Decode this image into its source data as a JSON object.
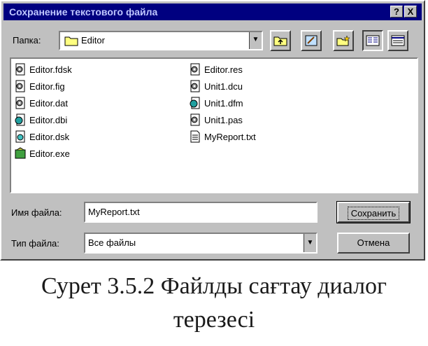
{
  "window": {
    "title": "Сохранение текстового файла",
    "help_button": "?",
    "close_button": "X"
  },
  "toolbar": {
    "folder_label": "Папка:",
    "folder_value": "Editor"
  },
  "files": [
    {
      "name": "Editor.fdsk",
      "icon": "gear-file-icon"
    },
    {
      "name": "Editor.fig",
      "icon": "gear-file-icon"
    },
    {
      "name": "Editor.dat",
      "icon": "gear-file-icon"
    },
    {
      "name": "Editor.dbi",
      "icon": "globe-file-icon"
    },
    {
      "name": "Editor.dsk",
      "icon": "disk-file-icon"
    },
    {
      "name": "Editor.exe",
      "icon": "exe-file-icon"
    },
    {
      "name": "Editor.res",
      "icon": "gear-file-icon"
    },
    {
      "name": "Unit1.dcu",
      "icon": "gear-file-icon"
    },
    {
      "name": "Unit1.dfm",
      "icon": "globe-file-icon"
    },
    {
      "name": "Unit1.pas",
      "icon": "gear-file-icon"
    },
    {
      "name": "MyReport.txt",
      "icon": "text-file-icon"
    }
  ],
  "form": {
    "filename_label": "Имя файла:",
    "filename_value": "MyReport.txt",
    "filetype_label": "Тип файла:",
    "filetype_value": "Все файлы",
    "save_button": "Сохранить",
    "cancel_button": "Отмена"
  },
  "caption": {
    "line1": "Сурет 3.5.2 Файлды сағтау диалог",
    "line2": "терезесі"
  }
}
